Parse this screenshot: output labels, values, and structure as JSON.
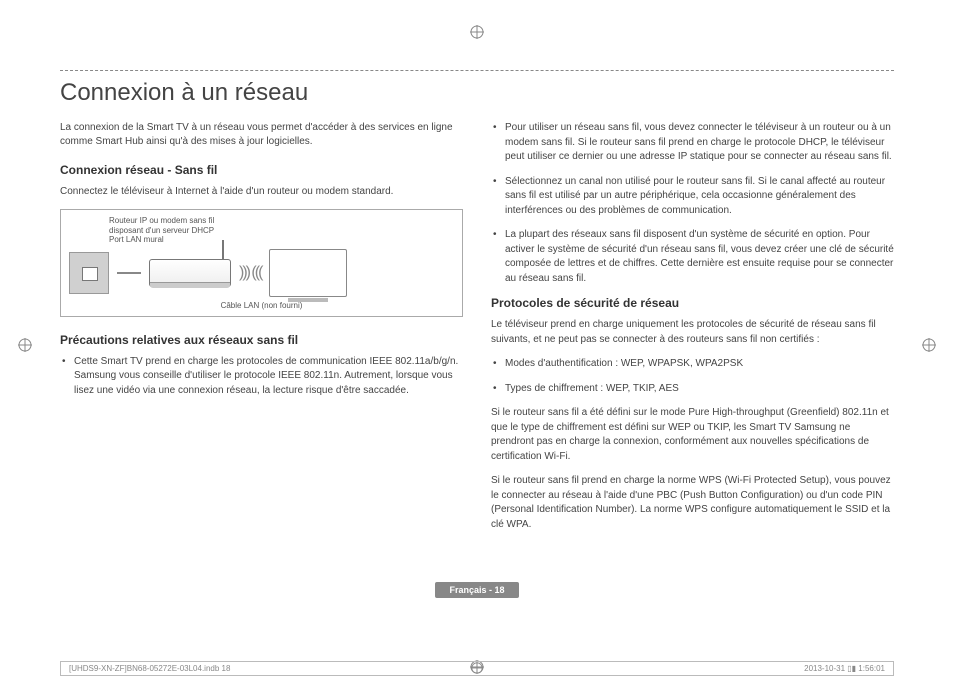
{
  "title": "Connexion à un réseau",
  "intro": "La connexion de la Smart TV à un réseau vous permet d'accéder à des services en ligne comme Smart Hub ainsi qu'à des mises à jour logicielles.",
  "section_wifi_h": "Connexion réseau - Sans fil",
  "section_wifi_sub": "Connectez le téléviseur à Internet à l'aide d'un routeur ou modem standard.",
  "diagram": {
    "label1": "Routeur IP ou modem sans fil",
    "label2": "disposant d'un serveur DHCP",
    "label3": "Port LAN mural",
    "cable_label": "Câble LAN (non fourni)"
  },
  "section_precautions_h": "Précautions relatives aux réseaux sans fil",
  "precaution_item": "Cette Smart TV prend en charge les protocoles de communication IEEE 802.11a/b/g/n. Samsung vous conseille d'utiliser le protocole IEEE 802.11n. Autrement, lorsque vous lisez une vidéo via une connexion réseau, la lecture risque d'être saccadée.",
  "right_bullets": [
    "Pour utiliser un réseau sans fil, vous devez connecter le téléviseur à un routeur ou à un modem sans fil. Si le routeur sans fil prend en charge le protocole DHCP, le téléviseur peut utiliser ce dernier ou une adresse IP statique pour se connecter au réseau sans fil.",
    "Sélectionnez un canal non utilisé pour le routeur sans fil. Si le canal affecté au routeur sans fil est utilisé par un autre périphérique, cela occasionne généralement des interférences ou des problèmes de communication.",
    "La plupart des réseaux sans fil disposent d'un système de sécurité en option. Pour activer le système de sécurité d'un réseau sans fil, vous devez créer une clé de sécurité composée de lettres et de chiffres. Cette dernière est ensuite requise pour se connecter au réseau sans fil."
  ],
  "section_protocols_h": "Protocoles de sécurité de réseau",
  "protocols_intro": "Le téléviseur prend en charge uniquement les protocoles de sécurité de réseau sans fil suivants, et ne peut pas se connecter à des routeurs sans fil non certifiés :",
  "protocols_list": [
    "Modes d'authentification : WEP, WPAPSK, WPA2PSK",
    "Types de chiffrement : WEP, TKIP, AES"
  ],
  "protocols_p1": "Si le routeur sans fil a été défini sur le mode Pure High-throughput (Greenfield) 802.11n et que le type de chiffrement est défini sur WEP ou TKIP, les Smart TV Samsung ne prendront pas en charge la connexion, conformément aux nouvelles spécifications de certification Wi-Fi.",
  "protocols_p2": "Si le routeur sans fil prend en charge la norme WPS (Wi-Fi Protected Setup), vous pouvez le connecter au réseau à l'aide d'une PBC (Push Button Configuration) ou d'un code PIN (Personal Identification Number). La norme WPS configure automatiquement le SSID et la clé WPA.",
  "page_badge": "Français - 18",
  "footer_left": "[UHDS9-XN-ZF]BN68-05272E-03L04.indb   18",
  "footer_right": "2013-10-31   ▯▮ 1:56:01"
}
